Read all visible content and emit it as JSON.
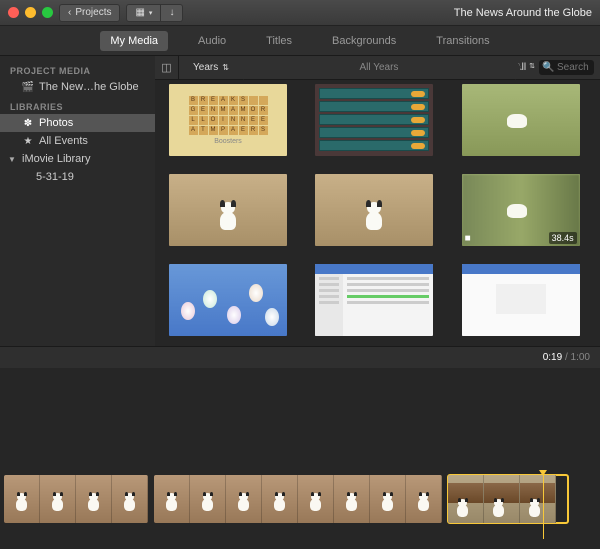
{
  "window": {
    "title": "The News Around the Globe"
  },
  "toolbar": {
    "back_label": "Projects",
    "colors": {
      "close": "#ff5f57",
      "min": "#febc2e",
      "max": "#28c840"
    }
  },
  "tabs": [
    {
      "label": "My Media",
      "active": true
    },
    {
      "label": "Audio",
      "active": false
    },
    {
      "label": "Titles",
      "active": false
    },
    {
      "label": "Backgrounds",
      "active": false
    },
    {
      "label": "Transitions",
      "active": false
    }
  ],
  "sidebar": {
    "project_media_header": "PROJECT MEDIA",
    "project_item": "The New…he Globe",
    "libraries_header": "LIBRARIES",
    "items": [
      {
        "label": "Photos",
        "icon": "flower",
        "selected": true
      },
      {
        "label": "All Events",
        "icon": "star",
        "selected": false
      }
    ],
    "library_group": "iMovie Library",
    "library_child": "5-31-19"
  },
  "filter": {
    "group_by": "Years",
    "scope": "All Years",
    "filter_label": "All",
    "search_placeholder": "Search"
  },
  "thumbnails": [
    {
      "kind": "word-game",
      "caption": "Boosters"
    },
    {
      "kind": "game-menu"
    },
    {
      "kind": "grass-dog"
    },
    {
      "kind": "floor-dog"
    },
    {
      "kind": "floor-dog"
    },
    {
      "kind": "blur-video",
      "duration": "38.4s",
      "is_video": true
    },
    {
      "kind": "eggs-sky"
    },
    {
      "kind": "settings-app"
    },
    {
      "kind": "settings-app-simple"
    }
  ],
  "timeline": {
    "current": "0:19",
    "total": "1:00",
    "clips": [
      {
        "frames": 4,
        "style": "dog-floor",
        "selected": false
      },
      {
        "frames": 8,
        "style": "dog-floor",
        "selected": false
      },
      {
        "frames": 3,
        "style": "dog-table",
        "selected": true
      }
    ]
  }
}
